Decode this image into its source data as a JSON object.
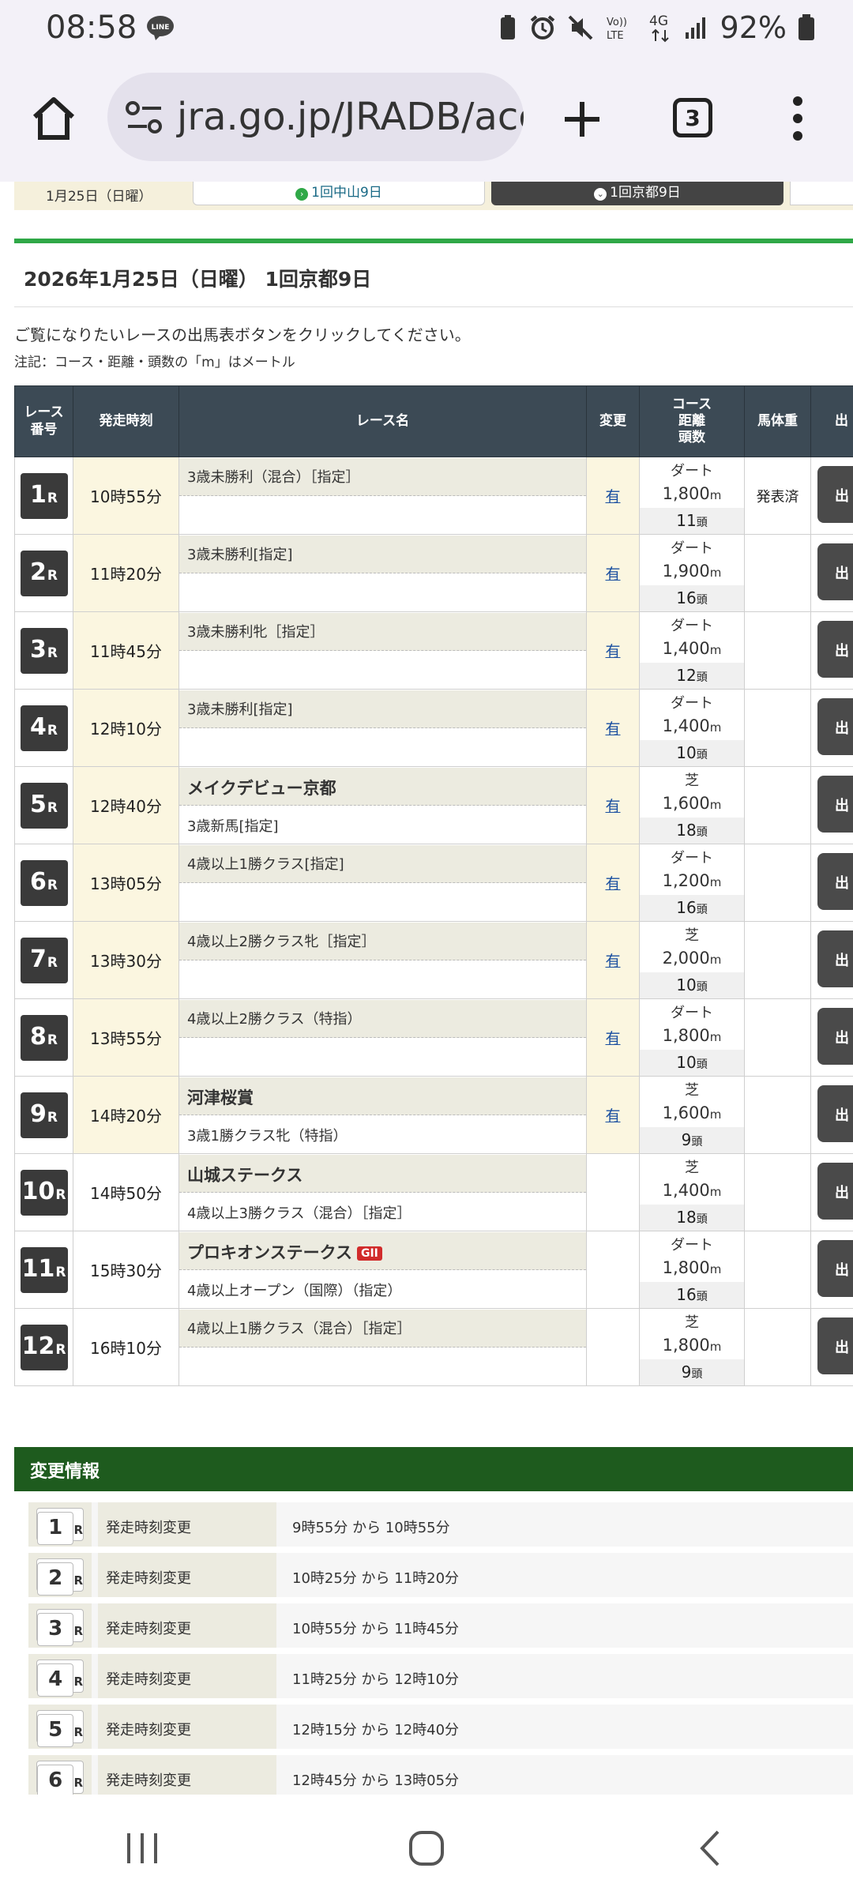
{
  "status": {
    "time": "08:58",
    "battery": "92%",
    "network": "4G"
  },
  "browser": {
    "url": "jra.go.jp/JRADB/acce",
    "tab_count": "3"
  },
  "strip": {
    "date": "1月25日（日曜）",
    "tab1": "1回中山9日",
    "tab2": "1回京都9日"
  },
  "heading": "2026年1月25日（日曜） 1回京都9日",
  "intro": "ご覧になりたいレースの出馬表ボタンをクリックしてください。",
  "note": "注記：コース・距離・頭数の「m」はメートル",
  "headers": {
    "num": "レース番号",
    "time": "発走時刻",
    "name": "レース名",
    "change": "変更",
    "course": "コース距離頭数",
    "weight": "馬体重",
    "btn": "出"
  },
  "races": [
    {
      "num": "1",
      "time": "10時55分",
      "top": "3歳未勝利（混合）［指定］",
      "bottom": "",
      "change": "有",
      "surface": "ダート",
      "dist": "1,800",
      "heads": "11",
      "weight": "発表済",
      "btn": "出"
    },
    {
      "num": "2",
      "time": "11時20分",
      "top": "3歳未勝利[指定]",
      "bottom": "",
      "change": "有",
      "surface": "ダート",
      "dist": "1,900",
      "heads": "16",
      "weight": "",
      "btn": "出"
    },
    {
      "num": "3",
      "time": "11時45分",
      "top": "3歳未勝利牝［指定］",
      "bottom": "",
      "change": "有",
      "surface": "ダート",
      "dist": "1,400",
      "heads": "12",
      "weight": "",
      "btn": "出"
    },
    {
      "num": "4",
      "time": "12時10分",
      "top": "3歳未勝利[指定]",
      "bottom": "",
      "change": "有",
      "surface": "ダート",
      "dist": "1,400",
      "heads": "10",
      "weight": "",
      "btn": "出"
    },
    {
      "num": "5",
      "time": "12時40分",
      "top": "メイクデビュー京都",
      "bottom": "3歳新馬[指定]",
      "change": "有",
      "surface": "芝",
      "dist": "1,600",
      "heads": "18",
      "weight": "",
      "btn": "出"
    },
    {
      "num": "6",
      "time": "13時05分",
      "top": "4歳以上1勝クラス[指定]",
      "bottom": "",
      "change": "有",
      "surface": "ダート",
      "dist": "1,200",
      "heads": "16",
      "weight": "",
      "btn": "出"
    },
    {
      "num": "7",
      "time": "13時30分",
      "top": "4歳以上2勝クラス牝［指定］",
      "bottom": "",
      "change": "有",
      "surface": "芝",
      "dist": "2,000",
      "heads": "10",
      "weight": "",
      "btn": "出"
    },
    {
      "num": "8",
      "time": "13時55分",
      "top": "4歳以上2勝クラス（特指）",
      "bottom": "",
      "change": "有",
      "surface": "ダート",
      "dist": "1,800",
      "heads": "10",
      "weight": "",
      "btn": "出"
    },
    {
      "num": "9",
      "time": "14時20分",
      "top": "河津桜賞",
      "bottom": "3歳1勝クラス牝（特指）",
      "change": "有",
      "surface": "芝",
      "dist": "1,600",
      "heads": "9",
      "weight": "",
      "btn": "出"
    },
    {
      "num": "10",
      "time": "14時50分",
      "top": "山城ステークス",
      "bottom": "4歳以上3勝クラス（混合）［指定］",
      "change": "",
      "surface": "芝",
      "dist": "1,400",
      "heads": "18",
      "weight": "",
      "btn": "出"
    },
    {
      "num": "11",
      "time": "15時30分",
      "top": "プロキオンステークス",
      "grade": "GII",
      "bottom": "4歳以上オープン（国際）（指定）",
      "change": "",
      "surface": "ダート",
      "dist": "1,800",
      "heads": "16",
      "weight": "",
      "btn": "出"
    },
    {
      "num": "12",
      "time": "16時10分",
      "top": "4歳以上1勝クラス（混合）［指定］",
      "bottom": "",
      "change": "",
      "surface": "芝",
      "dist": "1,800",
      "heads": "9",
      "weight": "",
      "btn": "出"
    }
  ],
  "units": {
    "m": "m",
    "heads": "頭",
    "r": "R"
  },
  "changes_title": "変更情報",
  "changes": [
    {
      "num": "1",
      "type": "発走時刻変更",
      "detail": "9時55分 から 10時55分"
    },
    {
      "num": "2",
      "type": "発走時刻変更",
      "detail": "10時25分 から 11時20分"
    },
    {
      "num": "3",
      "type": "発走時刻変更",
      "detail": "10時55分 から 11時45分"
    },
    {
      "num": "4",
      "type": "発走時刻変更",
      "detail": "11時25分 から 12時10分"
    },
    {
      "num": "5",
      "type": "発走時刻変更",
      "detail": "12時15分 から 12時40分"
    },
    {
      "num": "6",
      "type": "発走時刻変更",
      "detail": "12時45分 から 13時05分"
    }
  ]
}
